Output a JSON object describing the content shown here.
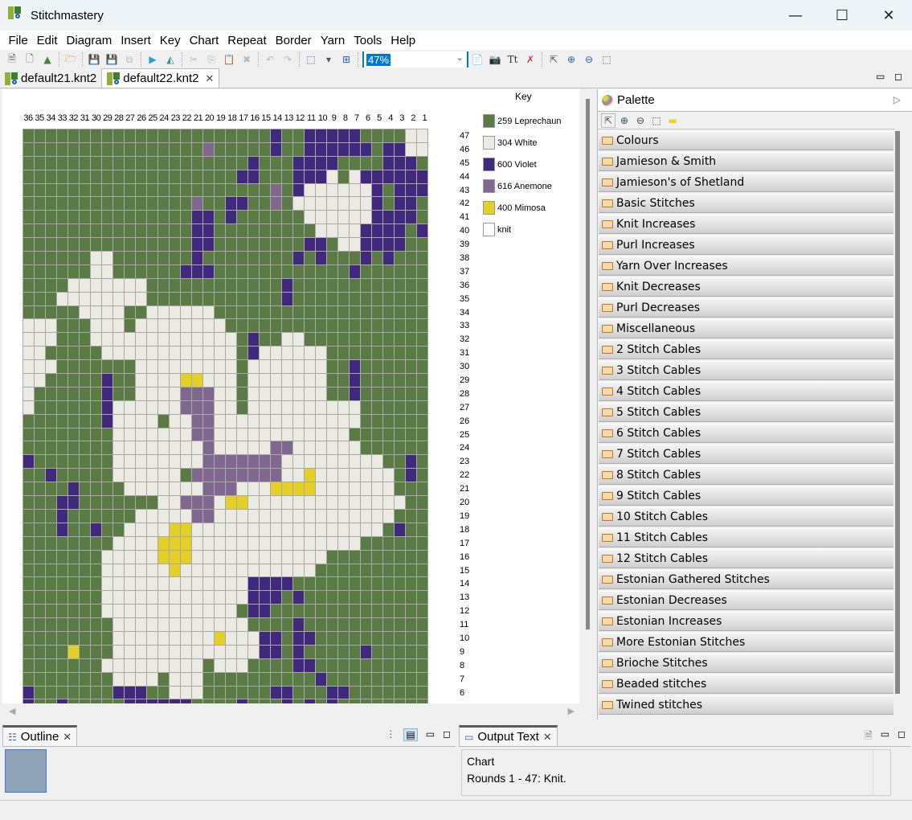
{
  "window": {
    "title": "Stitchmastery",
    "minimize": "—",
    "maximize": "☐",
    "close": "✕"
  },
  "menu": [
    "File",
    "Edit",
    "Diagram",
    "Insert",
    "Key",
    "Chart",
    "Repeat",
    "Border",
    "Yarn",
    "Tools",
    "Help"
  ],
  "toolbar": {
    "zoom_value": "47%",
    "buttons": [
      {
        "name": "new-chart",
        "glyph": "🗎",
        "enabled": true
      },
      {
        "name": "new-pattern",
        "glyph": "🗋",
        "enabled": true
      },
      {
        "name": "new-image-chart",
        "glyph": "▲",
        "enabled": true
      },
      {
        "name": "open",
        "glyph": "🗁",
        "enabled": true
      },
      {
        "name": "save",
        "glyph": "💾",
        "enabled": false
      },
      {
        "name": "save-as",
        "glyph": "💾",
        "enabled": true
      },
      {
        "name": "save-all",
        "glyph": "⧉",
        "enabled": false
      },
      {
        "name": "run",
        "glyph": "▶",
        "enabled": true
      },
      {
        "name": "mirror",
        "glyph": "◭",
        "enabled": true
      },
      {
        "name": "cut",
        "glyph": "✂",
        "enabled": false
      },
      {
        "name": "copy",
        "glyph": "⎘",
        "enabled": false
      },
      {
        "name": "paste",
        "glyph": "📋",
        "enabled": false
      },
      {
        "name": "delete",
        "glyph": "✖",
        "enabled": false
      },
      {
        "name": "undo",
        "glyph": "↶",
        "enabled": false
      },
      {
        "name": "redo",
        "glyph": "↷",
        "enabled": false
      },
      {
        "name": "select-grid",
        "glyph": "⬚",
        "enabled": true
      },
      {
        "name": "dropdown",
        "glyph": "▾",
        "enabled": true
      },
      {
        "name": "layout",
        "glyph": "⊞",
        "enabled": true
      }
    ],
    "right_buttons": [
      {
        "name": "export-text",
        "glyph": "📄"
      },
      {
        "name": "export-image",
        "glyph": "📷"
      },
      {
        "name": "text-format",
        "glyph": "Tt"
      },
      {
        "name": "remove",
        "glyph": "✗"
      },
      {
        "name": "select-arrow",
        "glyph": "⇱"
      },
      {
        "name": "zoom-in",
        "glyph": "⊕"
      },
      {
        "name": "zoom-out",
        "glyph": "⊖"
      },
      {
        "name": "marquee",
        "glyph": "⬚"
      }
    ]
  },
  "editor_tabs": [
    {
      "label": "default21.knt2",
      "active": false
    },
    {
      "label": "default22.knt2",
      "active": true,
      "close": "✕"
    }
  ],
  "chart": {
    "columns": [
      "36",
      "35",
      "34",
      "33",
      "32",
      "31",
      "30",
      "29",
      "28",
      "27",
      "26",
      "25",
      "24",
      "23",
      "22",
      "21",
      "20",
      "19",
      "18",
      "17",
      "16",
      "15",
      "14",
      "13",
      "12",
      "11",
      "10",
      "9",
      "8",
      "7",
      "6",
      "5",
      "4",
      "3",
      "2",
      "1"
    ],
    "rows_visible": [
      "47",
      "46",
      "45",
      "44",
      "43",
      "42",
      "41",
      "40",
      "39",
      "38",
      "37",
      "36",
      "35",
      "34",
      "33",
      "32",
      "31",
      "30",
      "29",
      "28",
      "27",
      "26",
      "25",
      "24",
      "23",
      "22",
      "21",
      "20",
      "19",
      "18",
      "17",
      "16",
      "15",
      "14",
      "13",
      "12",
      "11",
      "10",
      "9",
      "8",
      "7",
      "6"
    ],
    "colors": {
      "G": "#5b7b45",
      "W": "#ebebe4",
      "V": "#40297c",
      "A": "#80678f",
      "Y": "#e3cf26"
    },
    "grid": [
      "GGGGGGGGGGGGGGGGGGGGGGVGGVVVVVGGGGWW",
      "GGGGGGGGGGGGGGGGAGGGGGVGGVVVVVVGVVWW",
      "GGGGGGGGGGGGGGGGGGGGVGGGVVVVGGGGVVVG",
      "GGGGGGGGGGGGGGGGGGGVVGGGVVVWGWVVVVVV",
      "GGGGGGGGGGGGGGGGGGGGGGAGVWWWWWWVGVVV",
      "GGGGGGGGGGGGGGGAGGVVGGAGWWWWWWWVGVVG",
      "GGGGGGGGGGGGGGGVVGVGGGGGGWWWWWWVVVVG",
      "GGGGGGGGGGGGGGGVVGGGGGGGGGWWWWVVVVGV",
      "GGGGGGGGGGGGGGGVVGGGGGGGGVVGWWVVVVGG",
      "GGGGGGWWGGGGGGGVGGGGGGGGVGVGGGVGVGGG",
      "GGGGGGWWGGGGGGVVVGGGGGGGGGGGGVGGGGGG",
      "GGGGWWWWWWWGGGGGGGGGGGGVGGGGGGGGGGGG",
      "GGGWWWWWWWWGGGGGGGGGGGGVGGGGGGGGGGGG",
      "GGGGGWWWWGGWWWWWWGGGGGGGGGGGGGGGGGGG",
      "WWWGGGWWWGWWWWWWWWGGGGGGGGGGGGGGGGGG",
      "WWWGGGWWWWWWWWWWWWWGVGGWWGGGGGGGGGGG",
      "WWGGGGGWWWWWWWWWWWWGVWWWWWWGGGGGGGGG",
      "WWWGGGGGGGWWWWWWWWWGWWWWWWWGGVGGGGGG",
      "WWGGGGGVGGWWWWYYWWWGWWWWWWWGGVGGGGGG",
      "WGGGGGGVGGWWWWAAAWWGWWWWWWWGGVGGGGGG",
      "WGGGGGGVWWWWWWAAAWWGWWWWWWWWWWGGGGGG",
      "GGGGGGGVWWWWGWWAAWWWWWWWWWWWWWGGGGGG",
      "GGGGGGGGWWWWWWWAAWWWWWWWWWWWWGGGGGGG",
      "GGGGGGGGWWWWWWWWAWWWWWAAWWWWWWGGGGGG",
      "VGGGGGGGWWWWWWWWAAAAAAAWWWWWWWWWGGVG",
      "GGVGGGGGWWWWWWGAAAAAAAAWWYWWWWWWWGVG",
      "GGGGVGGGGWWWWWWWAAAWWWYYYYWWWWWWWGGG",
      "GGGVVGGGGGGGWWAAAWYYWWWWWWWWWWWWWWGG",
      "GGGVGGGGGGWWWWWAAWWWWWWWWWWWWWWWWGGG",
      "GGGVGGVGGWWWWYYWWWWWWWWWWWWWWWWWGVGG",
      "GGGGGGGGWWWWYYYWWWWWWWWWWWWWWWGGGGGG",
      "GGGGGGGWWWWWYYYWWWWWWWWWWWWGGGGGGGGG",
      "GGGGGGGWWWWWWYWWWWWWWWWWWWGGGGGGGGGG",
      "GGGGGGGWWWWWWWWWWWWWVVVVGGGGGGGGGGGG",
      "GGGGGGGWWWWWWWWWWWWWVVVGVGGGGGGGGGGG",
      "GGGGGGGWWWWWWWWWWWWGVVGGGGGGGGGGGGGG",
      "GGGGGGGGWWWWWWWWWWWWGGGGVGGGGGGGGGGG",
      "GGGGGGGGWWWWWWWWWYWWWVVGVVGGGGGGGGGG",
      "GGGGYGGGWWWWWWWWWWWWWVVGVGGGGGVGGGGG",
      "GGGGGGGWWWWWWWWWGWWWGGGGVVGGGGGGGGGG",
      "GGGGGGGGWWWWGWWWGGGGGGGGGGVGGGGGGGGG",
      "VGGGGGGGVVVGGWWWGGGGGGVVGGGVVGGGGGGG",
      "VGGVGGGGGVVVVVVGGGGVGGGVGVGVGGGGGGGG"
    ]
  },
  "key": {
    "title": "Key",
    "items": [
      {
        "label": "259 Leprechaun",
        "color": "#5b7b45"
      },
      {
        "label": "304 White",
        "color": "#ebebe4"
      },
      {
        "label": "600 Violet",
        "color": "#40297c"
      },
      {
        "label": "616 Anemone",
        "color": "#80678f"
      },
      {
        "label": "400 Mimosa",
        "color": "#e3cf26"
      },
      {
        "label": "knit",
        "color": "#ffffff"
      }
    ]
  },
  "palette": {
    "title": "Palette",
    "collapse_glyph": "▷",
    "tools": [
      {
        "name": "select",
        "glyph": "⇱"
      },
      {
        "name": "zoom-in",
        "glyph": "⊕"
      },
      {
        "name": "zoom-out",
        "glyph": "⊖"
      },
      {
        "name": "marquee",
        "glyph": "⬚"
      },
      {
        "name": "note",
        "glyph": "▬"
      }
    ],
    "drawers": [
      "Colours",
      "Jamieson & Smith",
      "Jamieson's of Shetland",
      "Basic Stitches",
      "Knit Increases",
      "Purl Increases",
      "Yarn Over Increases",
      "Knit Decreases",
      "Purl Decreases",
      "Miscellaneous",
      "2 Stitch Cables",
      "3 Stitch Cables",
      "4 Stitch Cables",
      "5 Stitch Cables",
      "6 Stitch Cables",
      "7 Stitch Cables",
      "8 Stitch Cables",
      "9 Stitch Cables",
      "10 Stitch Cables",
      "11 Stitch Cables",
      "12 Stitch Cables",
      "Estonian Gathered Stitches",
      "Estonian Decreases",
      "Estonian Increases",
      "More Estonian Stitches",
      "Brioche Stitches",
      "Beaded stitches",
      "Twined stitches"
    ]
  },
  "outline": {
    "title": "Outline",
    "close": "✕"
  },
  "output": {
    "title": "Output Text",
    "close": "✕",
    "lines": [
      "Chart",
      "Rounds 1 - 47: Knit."
    ]
  }
}
